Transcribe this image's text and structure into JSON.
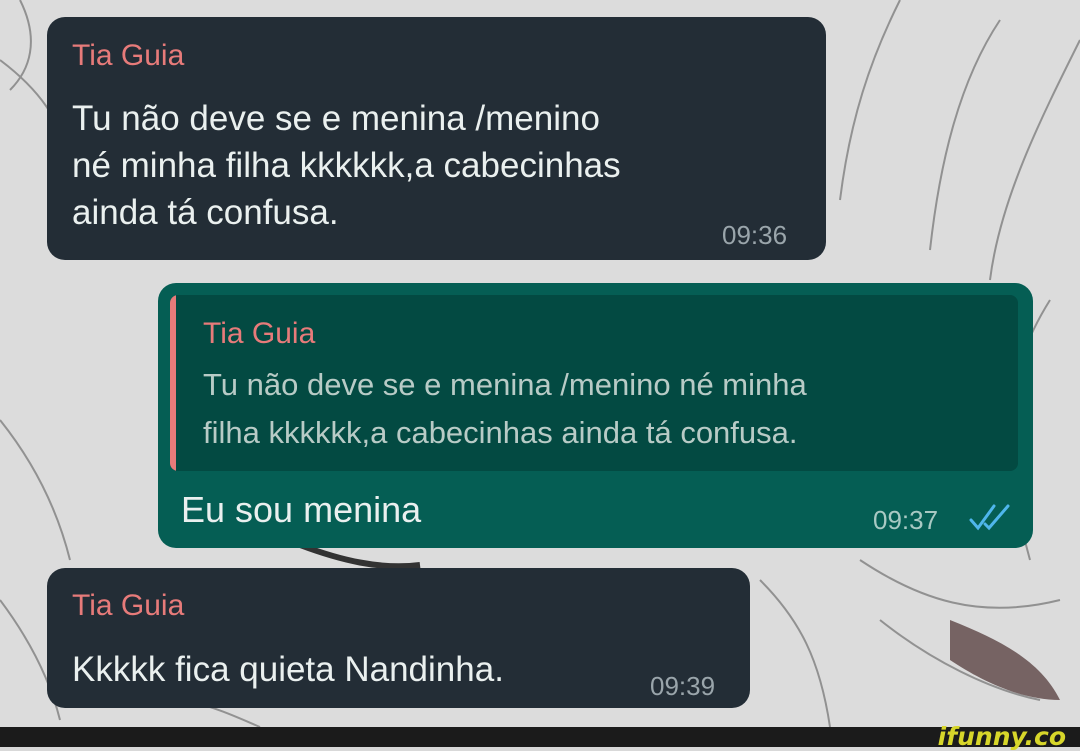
{
  "messages": [
    {
      "sender": "Tia Guia",
      "text": "Tu não deve se e menina /menino\nné minha filha kkkkkk,a cabecinhas\nainda tá confusa.",
      "time": "09:36"
    },
    {
      "quote_sender": "Tia Guia",
      "quote_text": "Tu não deve se e menina /menino né minha\nfilha kkkkkk,a cabecinhas ainda tá confusa.",
      "text": "Eu sou menina",
      "time": "09:37",
      "status_icon": "double-check-icon",
      "status_color": "#4fb6ec"
    },
    {
      "sender": "Tia Guia",
      "text": "Kkkkk fica quieta Nandinha.",
      "time": "09:39"
    }
  ],
  "watermark": "ifunny.co",
  "colors": {
    "incoming_bubble": "#232d36",
    "outgoing_bubble": "#055e54",
    "sender_name": "#e77b7a",
    "watermark": "#d7d62a"
  }
}
